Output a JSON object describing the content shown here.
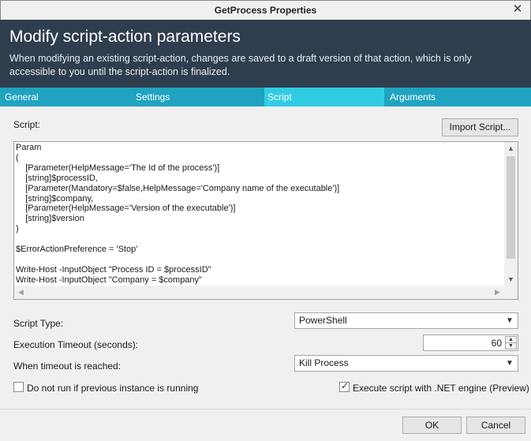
{
  "window": {
    "title": "GetProcess Properties",
    "close": "✕"
  },
  "header": {
    "title": "Modify script-action parameters",
    "description": "When modifying an existing script-action, changes are saved to a draft version of that action, which is only accessible to you until the script-action is finalized."
  },
  "tabs": [
    {
      "label": "General",
      "active": false
    },
    {
      "label": "Settings",
      "active": false
    },
    {
      "label": "Script",
      "active": true
    },
    {
      "label": "Arguments",
      "active": false
    }
  ],
  "script": {
    "label": "Script:",
    "import_button": "Import Script...",
    "code": "Param\n(\n    [Parameter(HelpMessage='The Id of the process')]\n    [string]$processID,\n    [Parameter(Mandatory=$false,HelpMessage='Company name of the executable')]\n    [string]$company,\n    [Parameter(HelpMessage='Version of the executable')]\n    [string]$version\n)\n\n$ErrorActionPreference = 'Stop'\n\nWrite-Host -InputObject \"Process ID = $processID\"\nWrite-Host -InputObject \"Company = $company\""
  },
  "fields": {
    "script_type_label": "Script Type:",
    "script_type_value": "PowerShell",
    "timeout_label": "Execution Timeout (seconds):",
    "timeout_value": "60",
    "on_timeout_label": "When timeout is reached:",
    "on_timeout_value": "Kill Process"
  },
  "options": {
    "no_run_label": "Do not run if previous instance is running",
    "no_run_checked": false,
    "dotnet_label": "Execute script with .NET engine (Preview)",
    "dotnet_checked": true
  },
  "footer": {
    "ok": "OK",
    "cancel": "Cancel"
  }
}
